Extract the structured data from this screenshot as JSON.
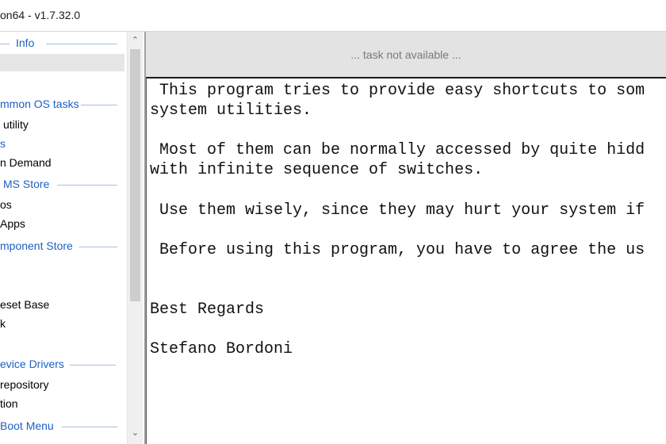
{
  "window": {
    "title": "on64 - v1.7.32.0"
  },
  "sidebar": {
    "items": [
      {
        "kind": "header",
        "label": "Info"
      },
      {
        "kind": "item",
        "label": ""
      },
      {
        "kind": "header",
        "label": "mmon OS tasks"
      },
      {
        "kind": "item",
        "label": "utility"
      },
      {
        "kind": "item",
        "label": "s"
      },
      {
        "kind": "item",
        "label": "n Demand"
      },
      {
        "kind": "header",
        "label": "MS Store"
      },
      {
        "kind": "item",
        "label": "os"
      },
      {
        "kind": "item",
        "label": "Apps"
      },
      {
        "kind": "header",
        "label": "mponent Store"
      },
      {
        "kind": "item",
        "label": "eset Base"
      },
      {
        "kind": "item",
        "label": "k"
      },
      {
        "kind": "header",
        "label": "evice Drivers"
      },
      {
        "kind": "item",
        "label": "repository"
      },
      {
        "kind": "item",
        "label": "tion"
      },
      {
        "kind": "header",
        "label": "Boot Menu"
      }
    ]
  },
  "scrollbar": {
    "up_glyph": "⌃",
    "down_glyph": "⌄"
  },
  "task_bar": {
    "status": "... task not available ..."
  },
  "content": {
    "lines": [
      " This program tries to provide easy shortcuts to som",
      "system utilities.",
      " Most of them can be normally accessed by quite hidd",
      "with infinite sequence of switches.",
      " Use them wisely, since they may hurt your system if",
      " Before using this program, you have to agree the us",
      "Best Regards",
      "Stefano Bordoni"
    ]
  }
}
